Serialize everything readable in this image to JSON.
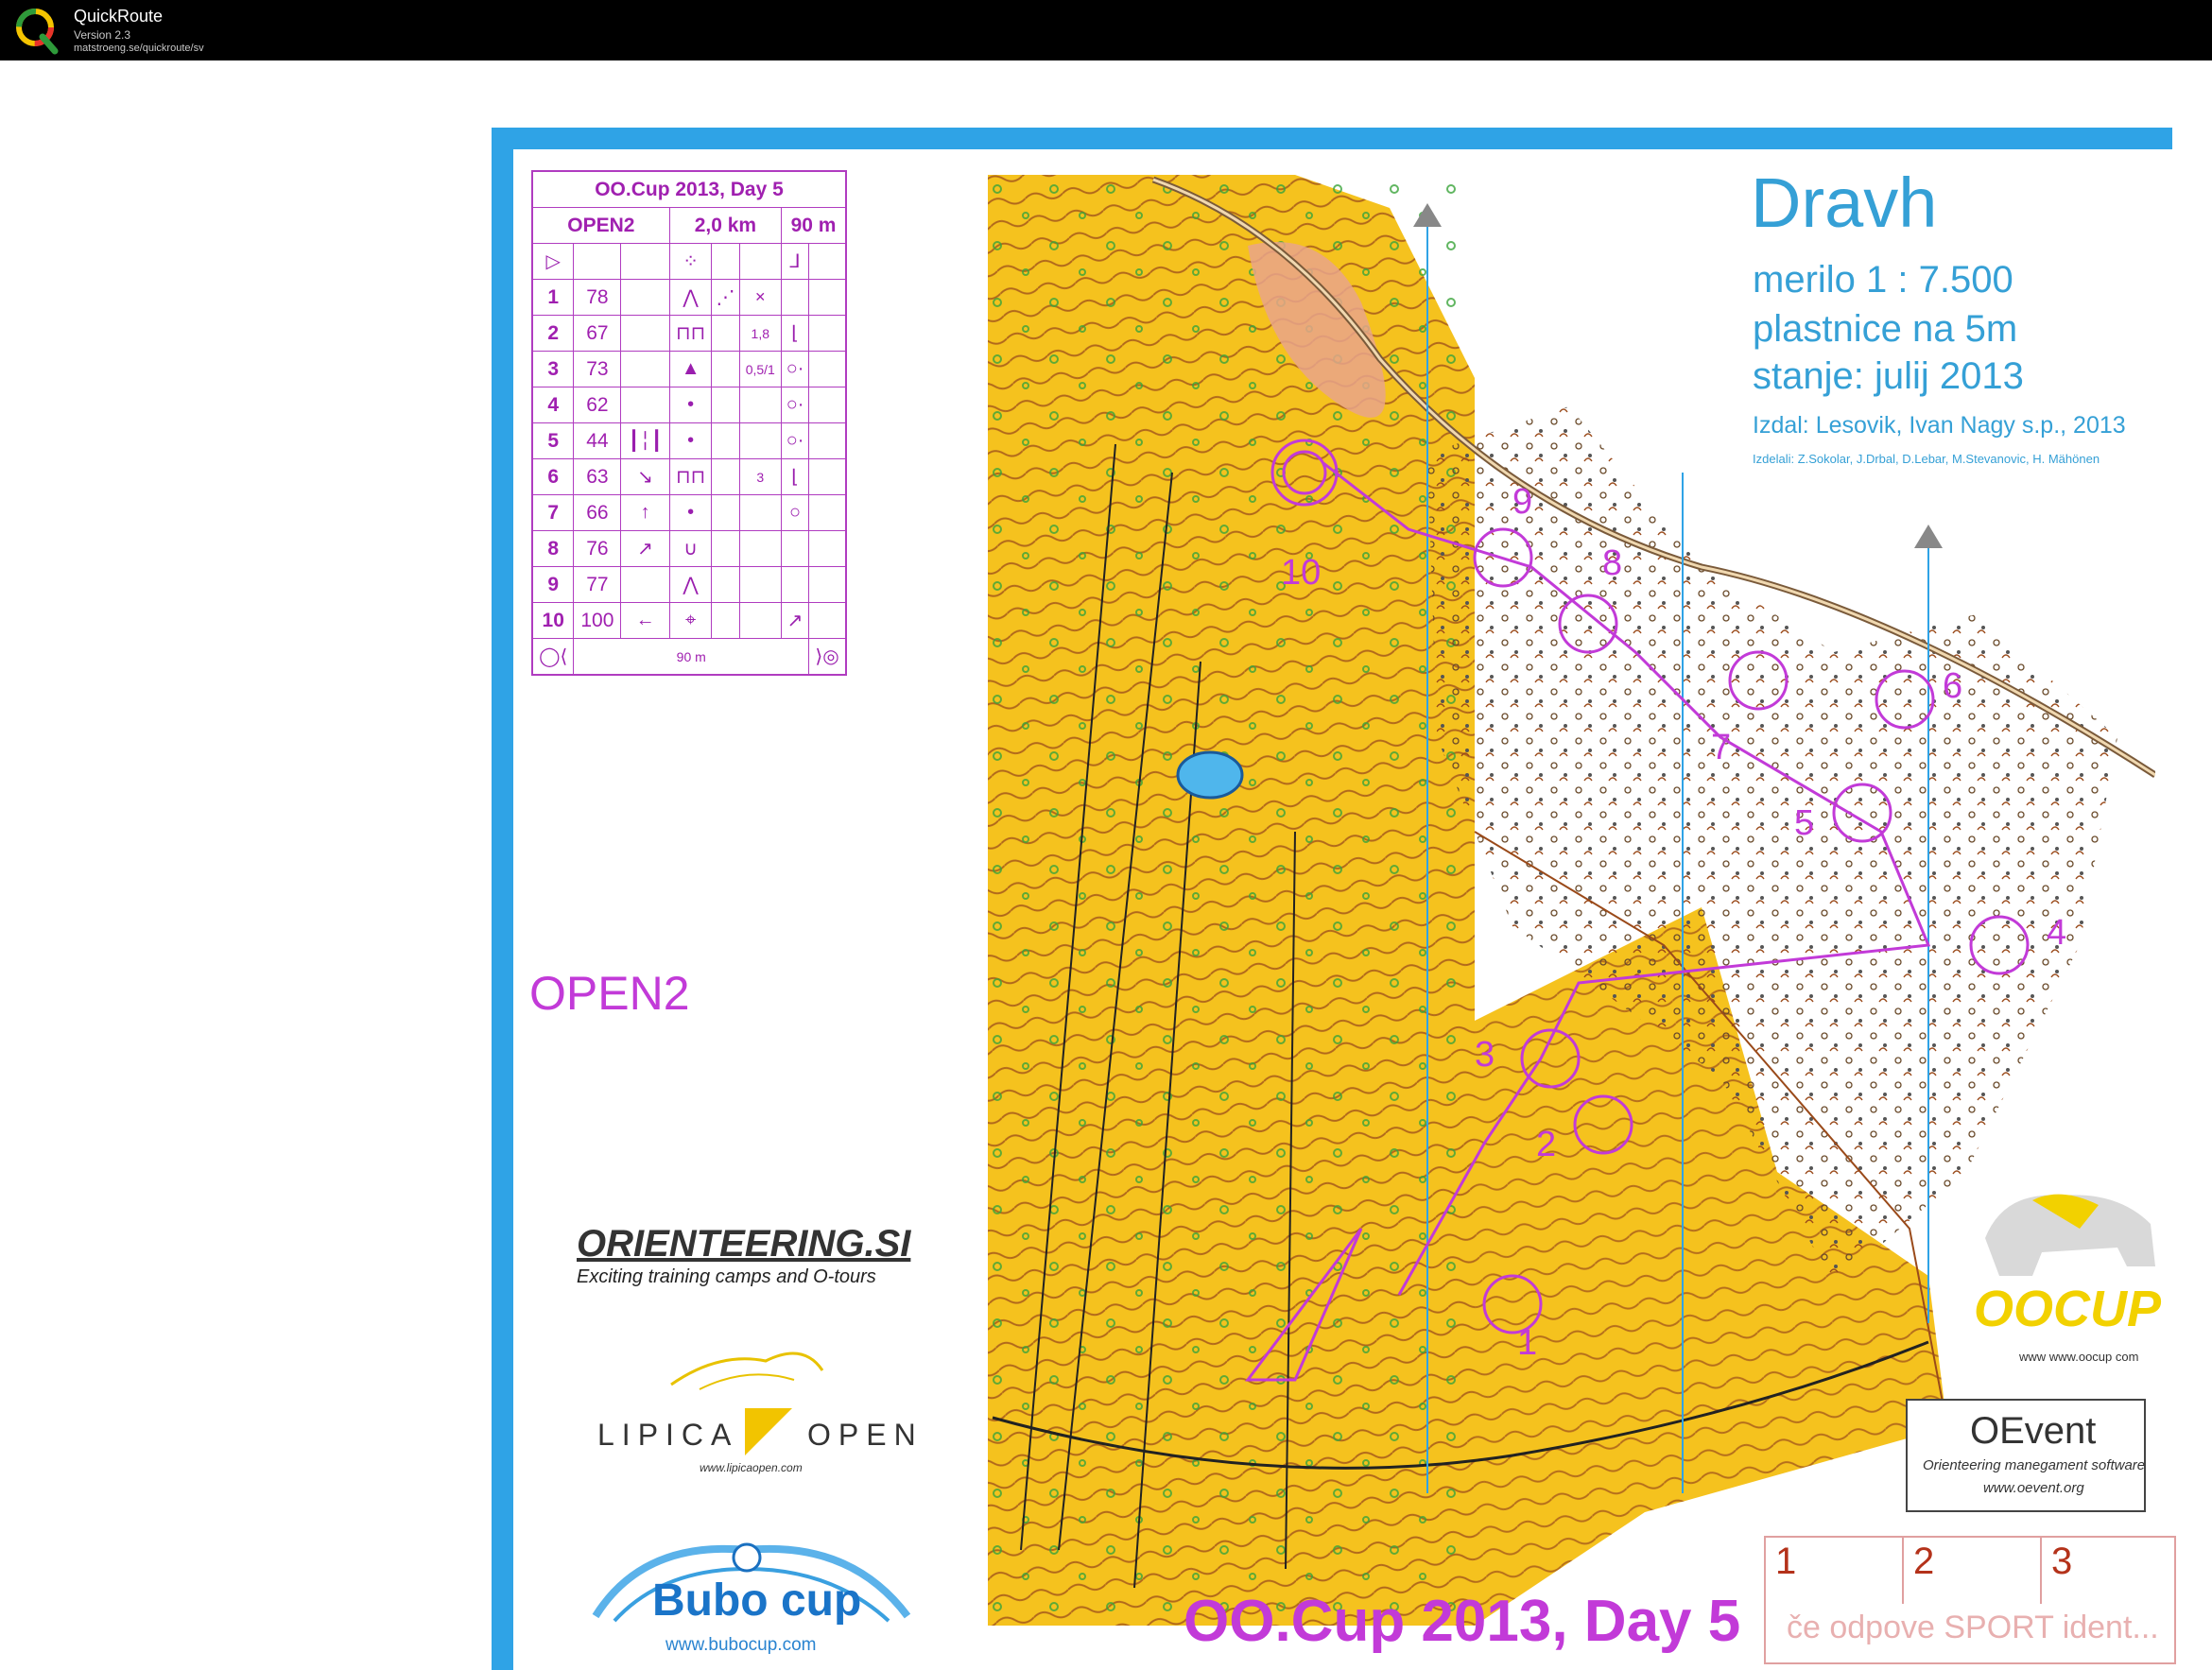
{
  "app": {
    "name": "QuickRoute",
    "version": "Version 2.3",
    "url": "matstroeng.se/quickroute/sv"
  },
  "description": {
    "title": "OO.Cup 2013, Day 5",
    "course": "OPEN2",
    "length": "2,0 km",
    "climb": "90 m",
    "controls": [
      {
        "n": "1",
        "code": "78",
        "c": "",
        "d": "⋀",
        "e": "⋰",
        "f": "✕",
        "g": "",
        "h": ""
      },
      {
        "n": "2",
        "code": "67",
        "c": "",
        "d": "⊓⊓",
        "e": "",
        "f": "1,8",
        "g": "⌊",
        "h": ""
      },
      {
        "n": "3",
        "code": "73",
        "c": "",
        "d": "▲",
        "e": "",
        "f": "0,5/1",
        "g": "○·",
        "h": ""
      },
      {
        "n": "4",
        "code": "62",
        "c": "",
        "d": "•",
        "e": "",
        "f": "",
        "g": "○·",
        "h": ""
      },
      {
        "n": "5",
        "code": "44",
        "c": "┃╎┃",
        "d": "•",
        "e": "",
        "f": "",
        "g": "○·",
        "h": ""
      },
      {
        "n": "6",
        "code": "63",
        "c": "↘",
        "d": "⊓⊓",
        "e": "",
        "f": "3",
        "g": "⌊",
        "h": ""
      },
      {
        "n": "7",
        "code": "66",
        "c": "↑",
        "d": "•",
        "e": "",
        "f": "",
        "g": "○",
        "h": ""
      },
      {
        "n": "8",
        "code": "76",
        "c": "↗",
        "d": "∪",
        "e": "",
        "f": "",
        "g": "",
        "h": ""
      },
      {
        "n": "9",
        "code": "77",
        "c": "",
        "d": "⋀",
        "e": "",
        "f": "",
        "g": "",
        "h": ""
      },
      {
        "n": "10",
        "code": "100",
        "c": "←",
        "d": "⌖",
        "e": "",
        "f": "",
        "g": "↗",
        "h": ""
      }
    ],
    "finish_distance": "90 m"
  },
  "map_info": {
    "name": "Dravh",
    "scale": "merilo 1 : 7.500",
    "contours": "plastnice na 5m",
    "status": "stanje: julij 2013",
    "publisher": "Izdal: Lesovik, Ivan Nagy s.p., 2013",
    "makers": "Izdelali: Z.Sokolar, J.Drbal, D.Lebar, M.Stevanovic, H. Mähönen"
  },
  "course_label": "OPEN2",
  "footer_title": "OO.Cup 2013, Day 5",
  "sponsors": {
    "orienteering_si": {
      "name": "ORIENTEERING.SI",
      "tagline": "Exciting training camps and O-tours"
    },
    "lipica": {
      "left": "LIPICA",
      "right": "OPEN",
      "url": "www.lipicaopen.com"
    },
    "bubo": {
      "name": "Bubo cup",
      "url": "www.bubocup.com"
    },
    "oocup": {
      "name": "OOCUP",
      "url": "www www.oocup com"
    },
    "oevent": {
      "name": "OEvent",
      "tagline": "Orienteering manegament software",
      "url": "www.oevent.org"
    }
  },
  "punch_box": {
    "boxes": [
      "1",
      "2",
      "3"
    ],
    "note": "če odpove SPORT ident..."
  },
  "control_numbers": [
    "1",
    "2",
    "3",
    "4",
    "5",
    "6",
    "7",
    "8",
    "9",
    "10"
  ],
  "colors": {
    "course": "#c23ad8",
    "map_yellow": "#f5c21e",
    "frame": "#2fa3e6",
    "contour": "#9a4a1a"
  }
}
